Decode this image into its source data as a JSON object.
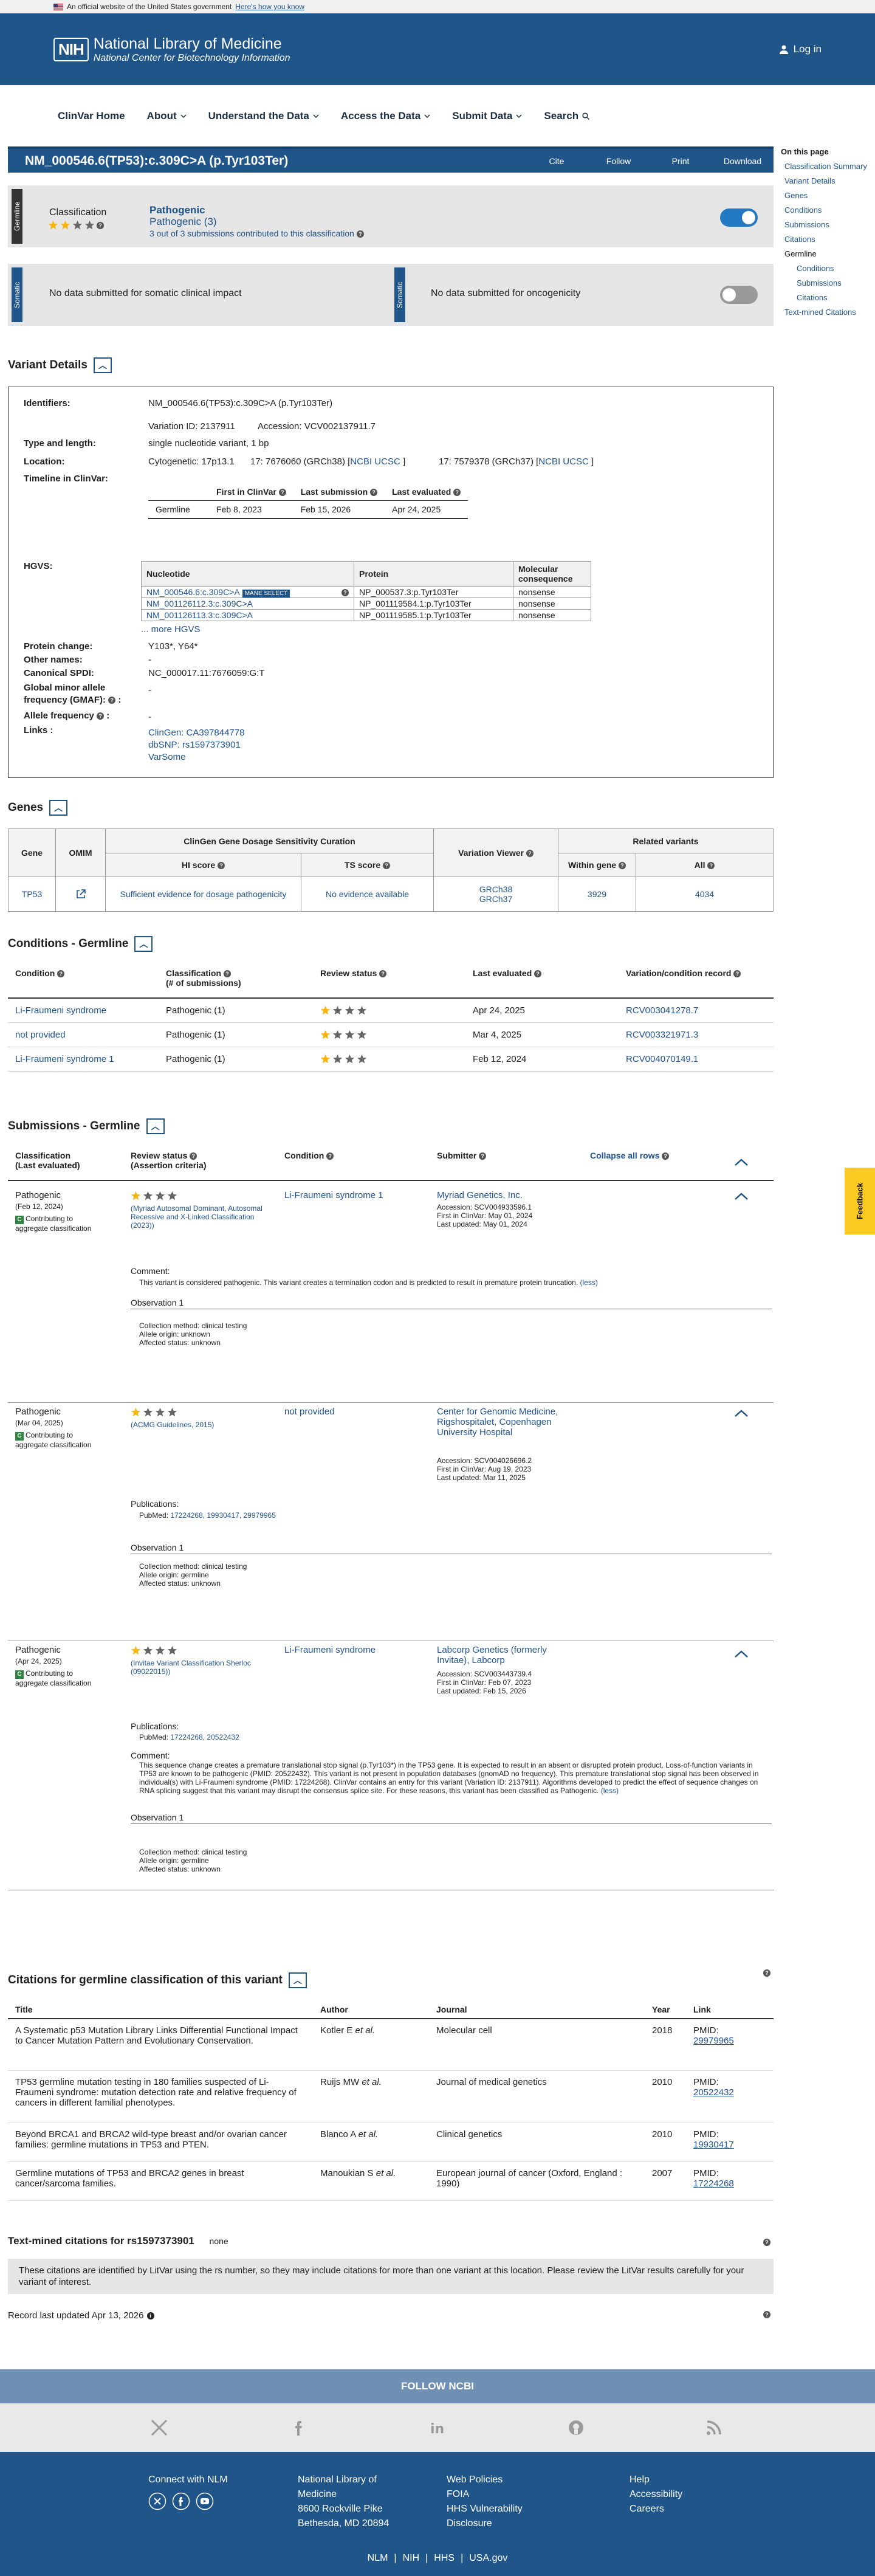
{
  "banner": {
    "text": "An official website of the United States government",
    "how": "Here's how you know"
  },
  "header": {
    "nih": "NIH",
    "title": "National Library of Medicine",
    "subtitle": "National Center for Biotechnology Information",
    "login": "Log in"
  },
  "nav": [
    "ClinVar Home",
    "About",
    "Understand the Data",
    "Access the Data",
    "Submit Data",
    "Search"
  ],
  "titlebar": {
    "title": "NM_000546.6(TP53):c.309C>A (p.Tyr103Ter)",
    "buttons": [
      "Cite",
      "Follow",
      "Print",
      "Download"
    ]
  },
  "side": {
    "heading": "On this page",
    "items": [
      "Classification Summary",
      "Variant Details",
      "Genes",
      "Conditions",
      "Submissions",
      "Citations",
      "Germline",
      "Conditions",
      "Submissions",
      "Citations",
      "Text-mined Citations"
    ]
  },
  "germline": {
    "tag": "Germline",
    "label": "Classification",
    "class1": "Pathogenic",
    "class2": "Pathogenic (3)",
    "subs": "3 out of 3 submissions contributed to this classification"
  },
  "somatic": {
    "tag1": "Somatic",
    "tag2": "Somatic",
    "text1": "No data submitted for somatic clinical impact",
    "text2": "No data submitted for oncogenicity"
  },
  "sections": {
    "variant": "Variant Details",
    "genes": "Genes",
    "conditions": "Conditions - Germline",
    "submissions": "Submissions - Germline",
    "citations": "Citations for germline classification of this variant",
    "textmined": "Text-mined citations for rs1597373901",
    "textmined_val": "none"
  },
  "variant": {
    "labels": [
      "Identifiers:",
      "Type and length:",
      "Location:",
      "Timeline in ClinVar:",
      "HGVS:",
      "Protein change:",
      "Other names:",
      "Canonical SPDI:",
      "Global minor allele",
      "frequency (GMAF)",
      "Allele frequency",
      "Links :"
    ],
    "identifier": "NM_000546.6(TP53):c.309C>A (p.Tyr103Ter)",
    "variation_id": "Variation ID: 2137911",
    "accession": "Accession: VCV002137911.7",
    "type": "single nucleotide variant, 1 bp",
    "cyto": "Cytogenetic: 17p13.1",
    "loc38": "17: 7676060 (GRCh38) [",
    "loc37": "17: 7579378 (GRCh37) [",
    "ncbi": "NCBI",
    "ucsc": "UCSC",
    "timeline_headers": [
      "First in ClinVar",
      "Last submission",
      "Last evaluated"
    ],
    "timeline_row": [
      "Germline",
      "Feb 8, 2023",
      "Feb 15, 2026",
      "Apr 24, 2025"
    ],
    "hgvs_headers": [
      "Nucleotide",
      "Protein",
      "Molecular consequence"
    ],
    "hgvs_rows": [
      [
        "NM_000546.6:c.309C>A",
        "NP_000537.3:p.Tyr103Ter",
        "nonsense"
      ],
      [
        "NM_001126112.3:c.309C>A",
        "NP_001119584.1:p.Tyr103Ter",
        "nonsense"
      ],
      [
        "NM_001126113.3:c.309C>A",
        "NP_001119585.1:p.Tyr103Ter",
        "nonsense"
      ]
    ],
    "mane": "MANE SELECT",
    "more": "... more HGVS",
    "protein": "Y103*, Y64*",
    "other": "-",
    "spdi": "NC_000017.11:7676059:G:T",
    "gmaf": "-",
    "af": "-",
    "links": [
      "ClinGen: CA397844778",
      "dbSNP: rs1597373901",
      "VarSome"
    ]
  },
  "genes": {
    "headers": [
      "Gene",
      "OMIM",
      "ClinGen Gene Dosage Sensitivity Curation",
      "HI score",
      "TS score",
      "Variation Viewer",
      "Related variants",
      "Within gene",
      "All"
    ],
    "row": {
      "gene": "TP53",
      "hi": "Sufficient evidence for dosage pathogenicity",
      "ts": "No evidence available",
      "grch38": "GRCh38",
      "grch37": "GRCh37",
      "within": "3929",
      "all": "4034"
    }
  },
  "conditions": {
    "headers": [
      "Condition",
      "Classification",
      "(# of submissions)",
      "Review status",
      "Last evaluated",
      "Variation/condition record"
    ],
    "rows": [
      {
        "cond": "Li-Fraumeni syndrome",
        "cls": "Pathogenic (1)",
        "stars": 1,
        "date": "Apr 24, 2025",
        "rec": "RCV003041278.7"
      },
      {
        "cond": "not provided",
        "cls": "Pathogenic (1)",
        "stars": 1,
        "date": "Mar 4, 2025",
        "rec": "RCV003321971.3"
      },
      {
        "cond": "Li-Fraumeni syndrome 1",
        "cls": "Pathogenic (1)",
        "stars": 1,
        "date": "Feb 12, 2024",
        "rec": "RCV004070149.1"
      }
    ]
  },
  "submissions": {
    "headers": [
      "Classification",
      "(Last evaluated)",
      "Review status",
      "(Assertion criteria)",
      "Condition",
      "Submitter",
      "Collapse all rows"
    ],
    "contrib": "Contributing to",
    "contrib2": "aggregate classification",
    "s1": {
      "cls": "Pathogenic",
      "date": "(Feb 12, 2024)",
      "criteria": "(Myriad Autosomal Dominant, Autosomal Recessive and X-Linked Classification (2023))",
      "cond": "Li-Fraumeni syndrome 1",
      "submitter": "Myriad Genetics, Inc.",
      "acc": "Accession: SCV004933596.1",
      "first": "First in ClinVar: May 01, 2024",
      "last": "Last updated: May 01, 2024",
      "comment_h": "Comment:",
      "comment": "This variant is considered pathogenic. This variant creates a termination codon and is predicted to result in premature protein truncation.",
      "less": "(less)",
      "obs": "Observation 1",
      "o1": "Collection method: clinical testing",
      "o2": "Allele origin: unknown",
      "o3": "Affected status: unknown"
    },
    "s2": {
      "cls": "Pathogenic",
      "date": "(Mar 04, 2025)",
      "criteria": "(ACMG Guidelines, 2015)",
      "cond": "not provided",
      "submitter": "Center for Genomic Medicine, Rigshospitalet, Copenhagen University Hospital",
      "acc": "Accession: SCV004026696.2",
      "first": "First in ClinVar: Aug 19, 2023",
      "last": "Last updated: Mar 11, 2025",
      "pubs_h": "Publications:",
      "pubmed": "PubMed:",
      "pubs": "17224268, 19930417, 29979965",
      "obs": "Observation 1",
      "o1": "Collection method: clinical testing",
      "o2": "Allele origin: germline",
      "o3": "Affected status: unknown"
    },
    "s3": {
      "cls": "Pathogenic",
      "date": "(Apr 24, 2025)",
      "criteria": "(Invitae Variant Classification Sherloc (09022015))",
      "cond": "Li-Fraumeni syndrome",
      "submitter": "Labcorp Genetics (formerly Invitae), Labcorp",
      "acc": "Accession: SCV003443739.4",
      "first": "First in ClinVar: Feb 07, 2023",
      "last": "Last updated: Feb 15, 2026",
      "pubs_h": "Publications:",
      "pubmed": "PubMed:",
      "pubs": "17224268, 20522432",
      "comment_h": "Comment:",
      "comment": "This sequence change creates a premature translational stop signal (p.Tyr103*) in the TP53 gene. It is expected to result in an absent or disrupted protein product. Loss-of-function variants in TP53 are known to be pathogenic (PMID: 20522432). This variant is not present in population databases (gnomAD no frequency). This premature translational stop signal has been observed in individual(s) with Li-Fraumeni syndrome (PMID: 17224268). ClinVar contains an entry for this variant (Variation ID: 2137911). Algorithms developed to predict the effect of sequence changes on RNA splicing suggest that this variant may disrupt the consensus splice site. For these reasons, this variant has been classified as Pathogenic.",
      "less": "(less)",
      "obs": "Observation 1",
      "o1": "Collection method: clinical testing",
      "o2": "Allele origin: germline",
      "o3": "Affected status: unknown"
    }
  },
  "citations": {
    "headers": [
      "Title",
      "Author",
      "Journal",
      "Year",
      "Link"
    ],
    "rows": [
      {
        "title": "A Systematic p53 Mutation Library Links Differential Functional Impact to Cancer Mutation Pattern and Evolutionary Conservation.",
        "author": "Kotler E",
        "etal": "et al.",
        "journal": "Molecular cell",
        "year": "2018",
        "pmid": "PMID:",
        "id": "29979965"
      },
      {
        "title": "TP53 germline mutation testing in 180 families suspected of Li-Fraumeni syndrome: mutation detection rate and relative frequency of cancers in different familial phenotypes.",
        "author": "Ruijs MW",
        "etal": "et al.",
        "journal": "Journal of medical genetics",
        "year": "2010",
        "pmid": "PMID:",
        "id": "20522432"
      },
      {
        "title": "Beyond BRCA1 and BRCA2 wild-type breast and/or ovarian cancer families: germline mutations in TP53 and PTEN.",
        "author": "Blanco A",
        "etal": "et al.",
        "journal": "Clinical genetics",
        "year": "2010",
        "pmid": "PMID:",
        "id": "19930417"
      },
      {
        "title": "Germline mutations of TP53 and BRCA2 genes in breast cancer/sarcoma families.",
        "author": "Manoukian S",
        "etal": "et al.",
        "journal": "European journal of cancer (Oxford, England : 1990)",
        "year": "2007",
        "pmid": "PMID:",
        "id": "17224268"
      }
    ]
  },
  "textmined_note": "These citations are identified by LitVar using the rs number, so they may include citations for more than one variant at this location. Please review the LitVar results carefully for your variant of interest.",
  "record_updated": "Record last updated Apr 13, 2026",
  "feedback": "Feedback",
  "footer": {
    "follow": "FOLLOW NCBI",
    "connect": "Connect with NLM",
    "addr": [
      "National Library of",
      "Medicine",
      "8600 Rockville Pike",
      "Bethesda, MD 20894"
    ],
    "links1": [
      "Web Policies",
      "FOIA",
      "HHS Vulnerability",
      "Disclosure"
    ],
    "links2": [
      "Help",
      "Accessibility",
      "Careers"
    ],
    "bottom": [
      "NLM",
      "NIH",
      "HHS",
      "USA.gov"
    ]
  },
  "colors": {
    "primary": "#20558a",
    "star": "#f6b50f",
    "green": "#2e8540"
  }
}
